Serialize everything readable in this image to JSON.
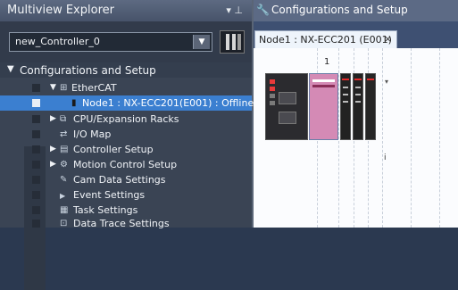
{
  "left_panel": {
    "title": "Multiview Explorer",
    "controls": "▾ ⊥",
    "controller_select": {
      "value": "new_Controller_0",
      "arrow": "▼"
    },
    "tree": {
      "header": {
        "toggle": "▼",
        "label": "Configurations and Setup"
      },
      "items": [
        {
          "toggle": "▼",
          "icon": "ethercat-icon",
          "icon_glyph": "⊞",
          "label": "EtherCAT"
        },
        {
          "toggle": "",
          "icon": "node-icon",
          "icon_glyph": "▮",
          "label": "Node1 : NX-ECC201(E001) : Offline"
        },
        {
          "toggle": "▶",
          "icon": "rack-icon",
          "icon_glyph": "⧉",
          "label": "CPU/Expansion Racks"
        },
        {
          "toggle": "",
          "icon": "io-map-icon",
          "icon_glyph": "⇄",
          "label": "I/O Map"
        },
        {
          "toggle": "▶",
          "icon": "controller-setup-icon",
          "icon_glyph": "▤",
          "label": "Controller Setup"
        },
        {
          "toggle": "▶",
          "icon": "motion-gear-icon",
          "icon_glyph": "⚙",
          "label": "Motion Control Setup"
        },
        {
          "toggle": "",
          "icon": "cam-data-icon",
          "icon_glyph": "✎",
          "label": "Cam Data Settings"
        },
        {
          "toggle": "",
          "icon": "event-flag-icon",
          "icon_glyph": "▶",
          "label": "Event Settings"
        },
        {
          "toggle": "",
          "icon": "task-icon",
          "icon_glyph": "▦",
          "label": "Task Settings"
        },
        {
          "toggle": "",
          "icon": "data-trace-icon",
          "icon_glyph": "⊡",
          "label": "Data Trace Settings"
        }
      ]
    }
  },
  "right_panel": {
    "title": "Configurations and Setup",
    "tab": {
      "label": "Node1 : NX-ECC201 (E001)",
      "close": "×"
    },
    "slot_number": "1",
    "expand_glyph": "▾",
    "info_glyph": "i"
  }
}
